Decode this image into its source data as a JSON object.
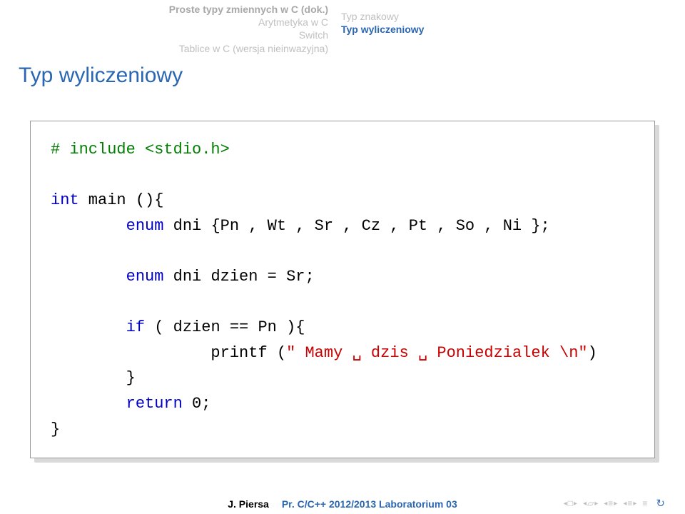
{
  "nav": {
    "left": [
      {
        "label": "Proste typy zmiennych w C (dok.)",
        "active": false,
        "bold": true
      },
      {
        "label": "Arytmetyka w C",
        "active": false
      },
      {
        "label": "Switch",
        "active": false
      },
      {
        "label": "Tablice w C (wersja nieinwazyjna)",
        "active": false
      }
    ],
    "right": [
      {
        "label": "Typ znakowy",
        "active": false
      },
      {
        "label": "Typ wyliczeniowy",
        "active": true
      }
    ]
  },
  "frametitle": "Typ wyliczeniowy",
  "code": {
    "l1_include": "# include <stdio.h>",
    "l3a": "int",
    "l3b": " main (){",
    "l4a": "        enum",
    "l4b": " dni {Pn , Wt , Sr , Cz , Pt , So , Ni };",
    "l6a": "        enum",
    "l6b": " dni dzien = Sr;",
    "l8a": "        if",
    "l8b": " ( dzien == Pn ){",
    "l9a": "                 printf (",
    "l9str": "\" Mamy ␣ dzis ␣ Poniedzialek \\n\"",
    "l9c": ")",
    "l10": "        }",
    "l11a": "        return",
    "l11b": " 0;",
    "l12": "}"
  },
  "footer": {
    "author": "J. Piersa",
    "title": "Pr. C/C++ 2012/2013 Laboratorium 03"
  }
}
